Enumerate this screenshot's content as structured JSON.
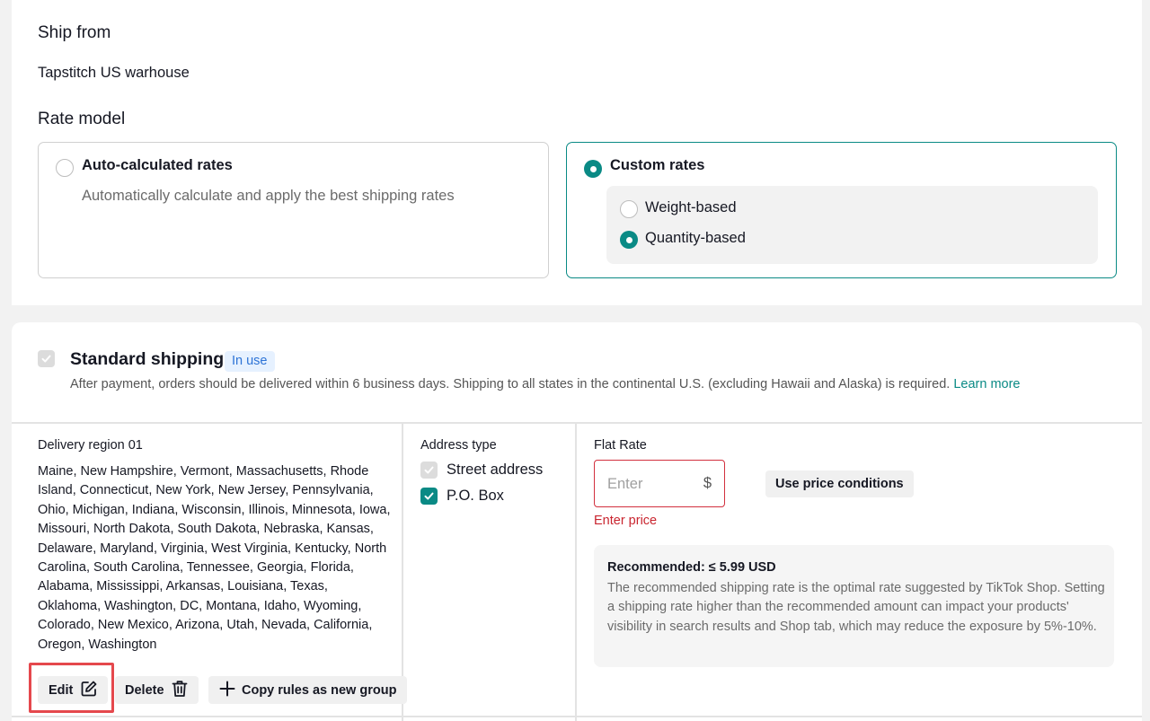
{
  "ship_from": {
    "title": "Ship from",
    "value": "Tapstitch US warhouse"
  },
  "rate_model": {
    "title": "Rate model",
    "auto": {
      "label": "Auto-calculated rates",
      "description": "Automatically calculate and apply the best shipping rates",
      "selected": false
    },
    "custom": {
      "label": "Custom rates",
      "selected": true,
      "options": [
        {
          "label": "Weight-based",
          "selected": false
        },
        {
          "label": "Quantity-based",
          "selected": true
        }
      ]
    }
  },
  "standard_shipping": {
    "title": "Standard shipping",
    "badge": "In use",
    "description": "After payment, orders should be delivered within 6 business days. Shipping to all states in the continental U.S. (excluding Hawaii and Alaska) is required.",
    "learn_more": "Learn more"
  },
  "region": {
    "title": "Delivery region 01",
    "states": "Maine, New Hampshire, Vermont, Massachusetts, Rhode Island, Connecticut, New York, New Jersey, Pennsylvania, Ohio, Michigan, Indiana, Wisconsin, Illinois, Minnesota, Iowa, Missouri, North Dakota, South Dakota, Nebraska, Kansas, Delaware, Maryland, Virginia, West Virginia, Kentucky, North Carolina, South Carolina, Tennessee, Georgia, Florida, Alabama, Mississippi, Arkansas, Louisiana, Texas, Oklahoma, Washington, DC, Montana, Idaho, Wyoming, Colorado, New Mexico, Arizona, Utah, Nevada, California, Oregon, Washington",
    "edit_label": "Edit",
    "delete_label": "Delete",
    "copy_label": "Copy rules as new group"
  },
  "address": {
    "title": "Address type",
    "options": [
      {
        "label": "Street address",
        "checked": true,
        "disabled": true
      },
      {
        "label": "P.O. Box",
        "checked": true,
        "disabled": false
      }
    ]
  },
  "flat_rate": {
    "title": "Flat Rate",
    "placeholder": "Enter",
    "value": "",
    "currency": "$",
    "error": "Enter price",
    "use_price_conditions": "Use price conditions",
    "recommended_title": "Recommended: ≤ 5.99 USD",
    "recommended_body": "The recommended shipping rate is the optimal rate suggested by TikTok Shop. Setting a shipping rate higher than the recommended amount can impact your products' visibility in search results and Shop tab, which may reduce the exposure by 5%-10%."
  },
  "colors": {
    "accent": "#0a8a85",
    "error": "#d2303e",
    "badge_text": "#2d73d6",
    "highlight": "#e5484d"
  }
}
